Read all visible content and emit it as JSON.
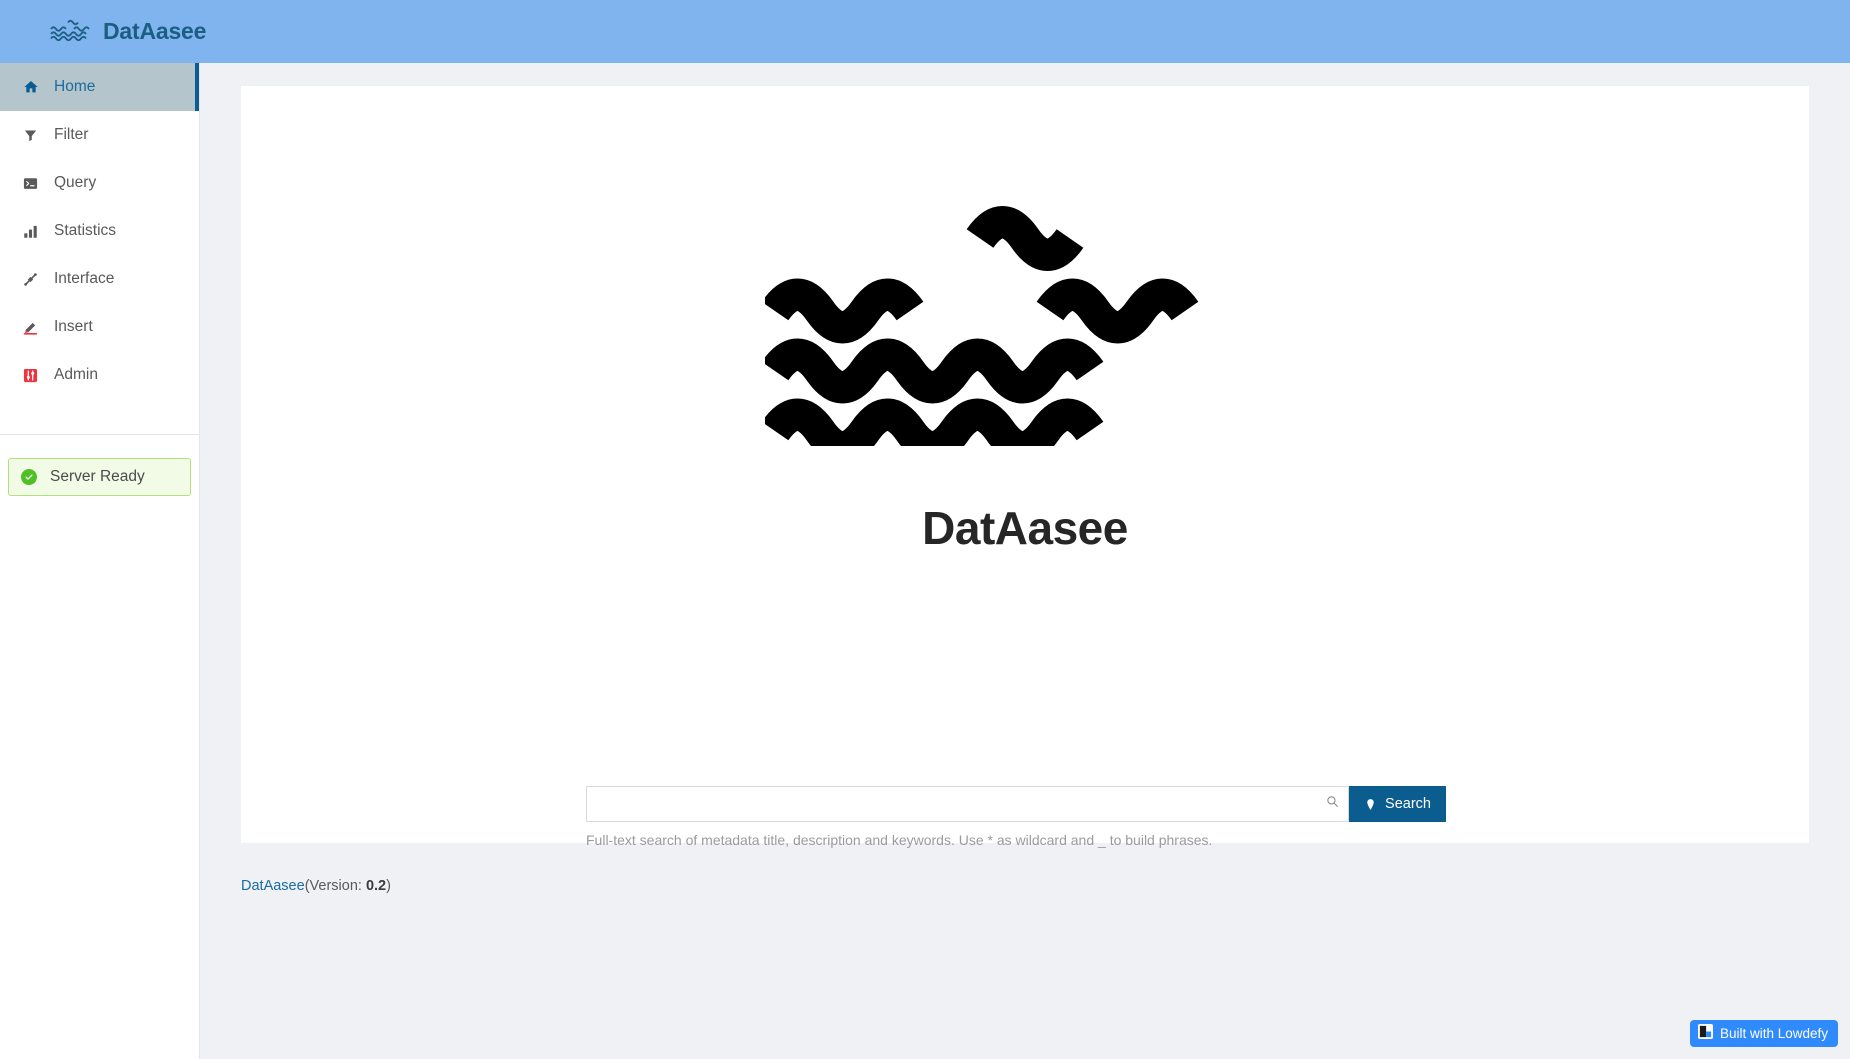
{
  "header": {
    "brand_name": "DatAasee",
    "logo_icon": "wave-logo-icon",
    "background_color": "#7fb4ee",
    "brand_color": "#1b5e82"
  },
  "sidebar": {
    "items": [
      {
        "label": "Home",
        "icon": "home-icon",
        "active": true
      },
      {
        "label": "Filter",
        "icon": "funnel-icon",
        "active": false
      },
      {
        "label": "Query",
        "icon": "terminal-icon",
        "active": false
      },
      {
        "label": "Statistics",
        "icon": "bar-chart-icon",
        "active": false
      },
      {
        "label": "Interface",
        "icon": "plug-icon",
        "active": false
      },
      {
        "label": "Insert",
        "icon": "pencil-icon",
        "active": false
      },
      {
        "label": "Admin",
        "icon": "sliders-icon",
        "active": false
      }
    ],
    "status": {
      "label": "Server Ready",
      "icon": "check-circle-icon",
      "color": "#4fbf26",
      "background_color": "#f2fbe6",
      "border_color": "#b3e07f"
    },
    "active_indicator_color": "#0a5c92",
    "active_background_color": "#b4c5cc"
  },
  "main": {
    "hero": {
      "logo_icon": "wave-logo-icon",
      "title": "DatAasee"
    },
    "search": {
      "value": "",
      "placeholder": "",
      "input_icon": "search-icon",
      "button_label": "Search",
      "button_icon": "search-pin-icon",
      "button_color": "#0b5c8f",
      "help_text": "Full-text search of metadata title, description and keywords. Use * as wildcard and _ to build phrases."
    }
  },
  "footer": {
    "project_link_label": "DatAasee",
    "version_prefix": "(Version: ",
    "version_value": "0.2",
    "version_suffix": ")",
    "link_color": "#1b6ba0"
  },
  "lowdefy_badge": {
    "label": "Built with Lowdefy",
    "icon": "lowdefy-logo-icon",
    "background_color": "#2f8bfb"
  }
}
